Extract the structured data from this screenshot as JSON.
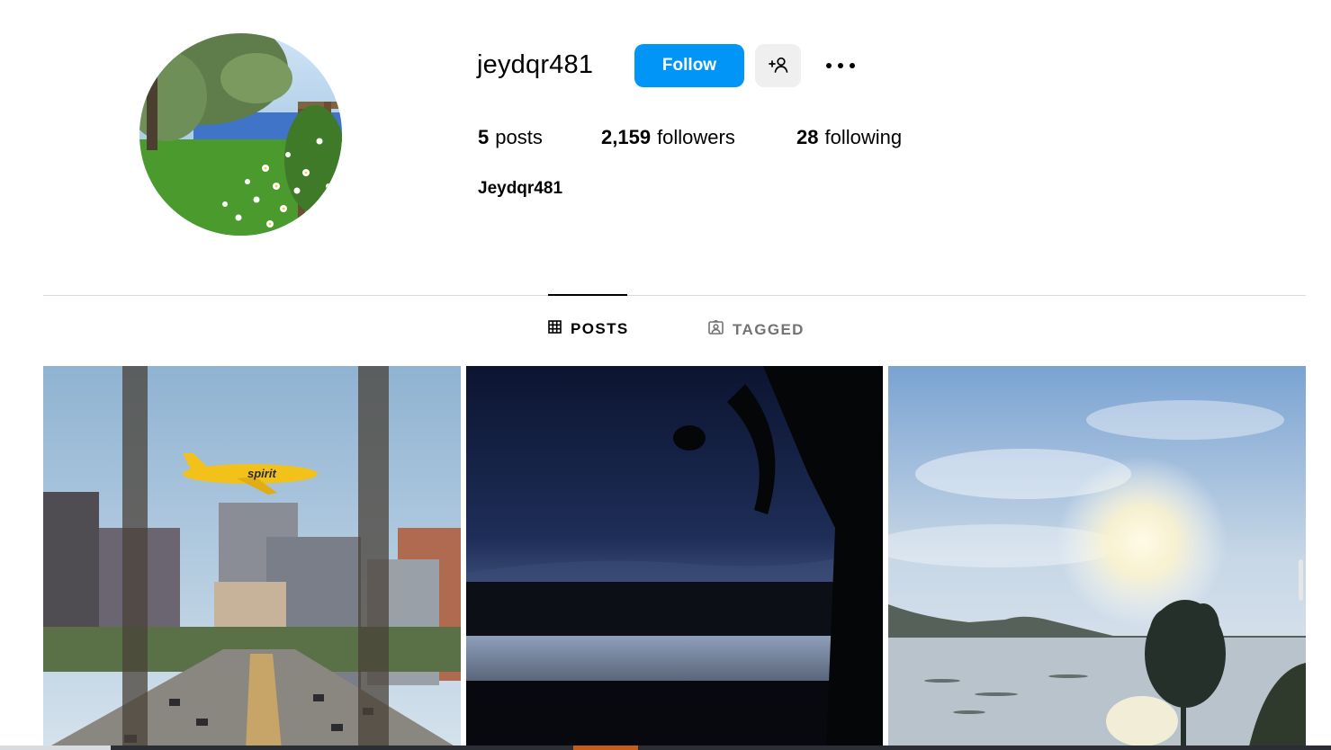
{
  "profile": {
    "username": "jeydqr481",
    "follow_label": "Follow",
    "full_name": "Jeydqr481",
    "avatar_icon": "profile-photo-meadow-lake"
  },
  "stats": {
    "posts_count": "5",
    "posts_label": "posts",
    "followers_count": "2,159",
    "followers_label": "followers",
    "following_count": "28",
    "following_label": "following"
  },
  "tabs": [
    {
      "label": "POSTS",
      "icon": "grid-icon",
      "active": true
    },
    {
      "label": "TAGGED",
      "icon": "tagged-icon",
      "active": false
    }
  ],
  "posts": [
    {
      "icon": "airplane-city-photo"
    },
    {
      "icon": "dark-lake-sunset-photo"
    },
    {
      "icon": "misty-lake-sun-photo"
    }
  ],
  "colors": {
    "follow_button": "#0095f6",
    "secondary_button": "#efefef",
    "divider": "#dbdbdb",
    "inactive_tab": "#737373"
  }
}
